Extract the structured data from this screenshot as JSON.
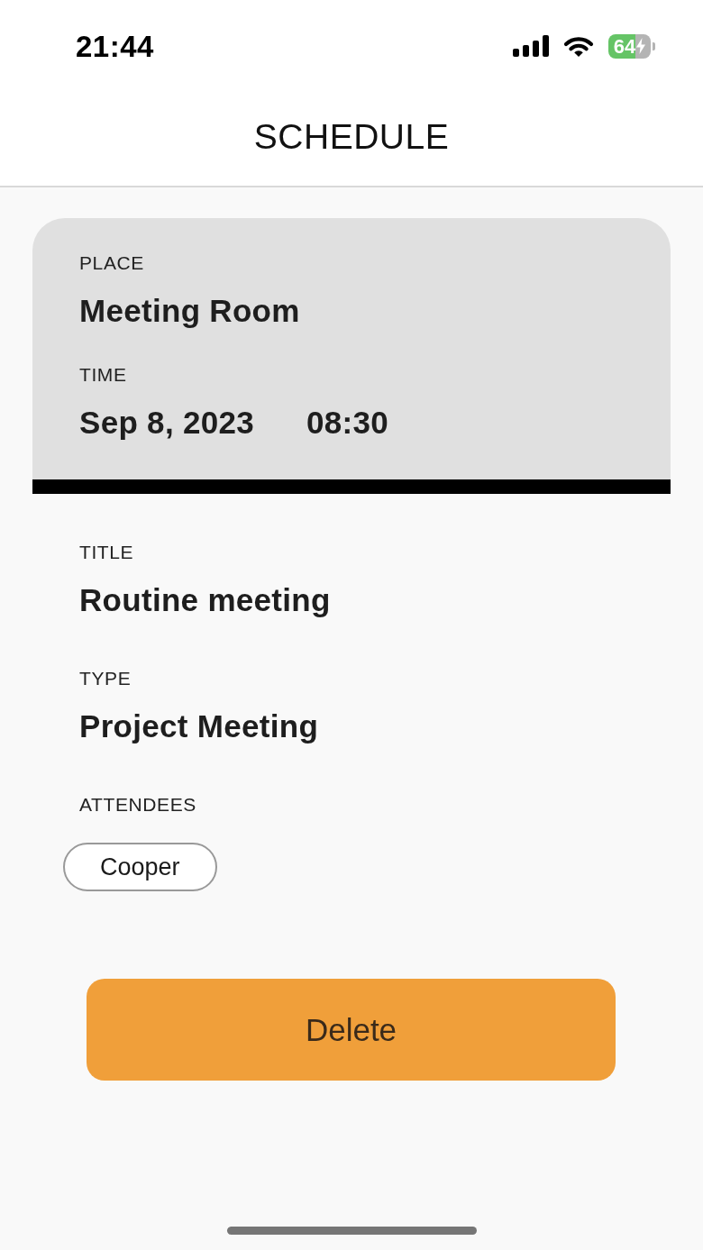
{
  "status_bar": {
    "time": "21:44",
    "battery": {
      "percent": "64",
      "charging": true
    }
  },
  "header": {
    "title": "SCHEDULE"
  },
  "summary_card": {
    "fields": [
      {
        "label": "PLACE",
        "values": [
          "Meeting Room"
        ]
      },
      {
        "label": "TIME",
        "values": [
          "Sep 8, 2023",
          "08:30"
        ]
      }
    ]
  },
  "details": [
    {
      "label": "TITLE",
      "value": "Routine meeting"
    },
    {
      "label": "TYPE",
      "value": "Project Meeting"
    }
  ],
  "attendees": {
    "label": "ATTENDEES",
    "items": [
      "Cooper"
    ]
  },
  "delete_button": {
    "label": "Delete"
  }
}
